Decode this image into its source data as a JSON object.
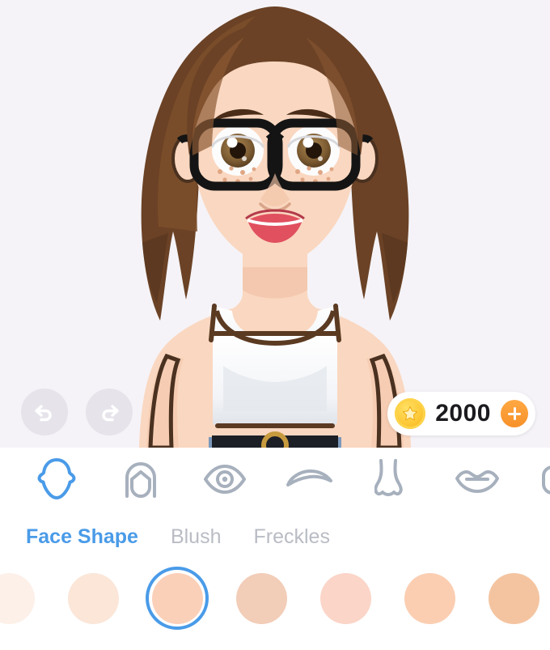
{
  "theme": {
    "canvas_bg": "#f5f3f7",
    "panel_bg": "#ffffff",
    "accent_blue": "#4a9be8",
    "muted_gray": "#b9bcc4",
    "icon_gray": "#a7b0bd",
    "coin_gold": "#fdc836",
    "plus_orange": "#f7912a"
  },
  "history": {
    "undo": {
      "label": "Undo",
      "icon": "undo-arrow-icon",
      "enabled": true
    },
    "redo": {
      "label": "Redo",
      "icon": "redo-arrow-icon",
      "enabled": true
    }
  },
  "currency": {
    "icon": "gold-star-coin-icon",
    "amount": "2000",
    "add_label": "+",
    "add_icon": "plus-icon"
  },
  "avatar": {
    "description": "Cartoon female avatar with shoulder-length brown wavy hair, black thick-rimmed glasses, brown eyes, freckles, red lips, white crop top, blue jeans with black belt",
    "colors": {
      "skin": "#fad7c0",
      "skin_shadow": "#f3c4a8",
      "hair": "#6b4226",
      "hair_light": "#8b5a33",
      "hair_dark": "#4e2f1a",
      "glasses": "#1a1a1a",
      "eye_iris": "#8b6a43",
      "lips": "#e0505f",
      "top": "#ffffff",
      "top_shadow": "#dfe3e8",
      "jeans": "#6f8cb0",
      "belt": "#1c1f26",
      "outline": "#4a3120"
    }
  },
  "categories": [
    {
      "id": "face-shape",
      "label": "Face Shape",
      "icon": "face-shape-icon",
      "selected": true
    },
    {
      "id": "hair",
      "label": "Hair",
      "icon": "hair-icon",
      "selected": false
    },
    {
      "id": "eyes",
      "label": "Eyes",
      "icon": "eye-icon",
      "selected": false
    },
    {
      "id": "eyebrows",
      "label": "Eyebrows",
      "icon": "eyebrow-icon",
      "selected": false
    },
    {
      "id": "nose",
      "label": "Nose",
      "icon": "nose-icon",
      "selected": false
    },
    {
      "id": "lips",
      "label": "Lips",
      "icon": "lips-icon",
      "selected": false
    },
    {
      "id": "glasses",
      "label": "Glasses",
      "icon": "glasses-icon",
      "selected": false
    }
  ],
  "tabs": [
    {
      "id": "face-shape",
      "label": "Face Shape",
      "active": true
    },
    {
      "id": "blush",
      "label": "Blush",
      "active": false
    },
    {
      "id": "freckles",
      "label": "Freckles",
      "active": false
    }
  ],
  "swatches": [
    {
      "index": 0,
      "color": "#fdf0e8",
      "selected": false
    },
    {
      "index": 1,
      "color": "#fbe6d8",
      "selected": false
    },
    {
      "index": 2,
      "color": "#fbd0b9",
      "selected": true
    },
    {
      "index": 3,
      "color": "#f2cdb8",
      "selected": false
    },
    {
      "index": 4,
      "color": "#fbd5c8",
      "selected": false
    },
    {
      "index": 5,
      "color": "#fbceb2",
      "selected": false
    },
    {
      "index": 6,
      "color": "#f4c4a0",
      "selected": false
    }
  ]
}
